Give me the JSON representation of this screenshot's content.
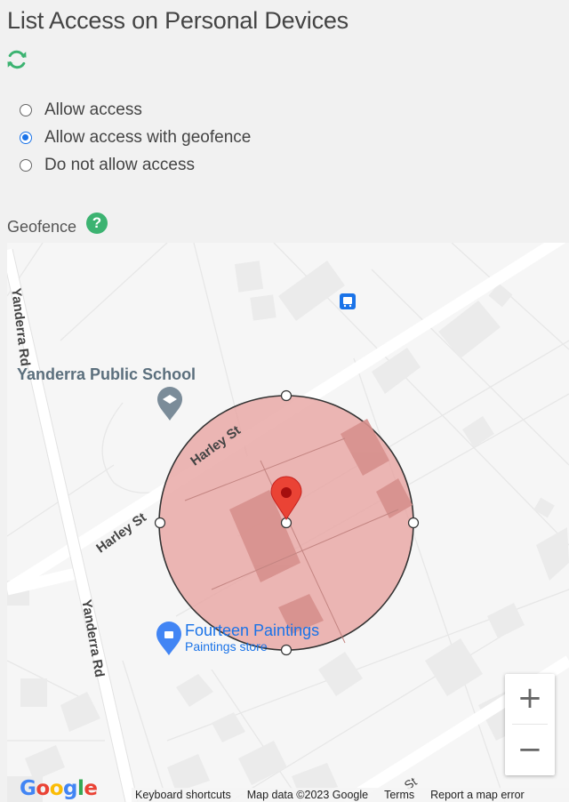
{
  "page": {
    "title": "List Access on Personal Devices",
    "refresh_icon": "refresh-icon",
    "accent_color": "#3cb371"
  },
  "access_options": {
    "selected": "Allow access with geofence",
    "items": [
      {
        "label": "Allow access",
        "checked": false
      },
      {
        "label": "Allow access with geofence",
        "checked": true
      },
      {
        "label": "Do not allow access",
        "checked": false
      }
    ]
  },
  "geofence": {
    "label": "Geofence",
    "help_icon": "?",
    "fill_color": "#e8a6a3",
    "marker_color": "#ea4335"
  },
  "map": {
    "streets": [
      "Yanderra Rd",
      "Harley St",
      "Harley St",
      "Yanderra Rd",
      "St"
    ],
    "places": [
      {
        "name": "Yanderra Public School",
        "icon": "school-icon"
      },
      {
        "name": "Fourteen Paintings",
        "subtitle": "Paintings store",
        "icon": "shopping-bag-icon"
      }
    ],
    "bus_stop_icon": "bus-icon",
    "zoom_in": "+",
    "zoom_out": "−",
    "logo": "Google",
    "footer": {
      "shortcuts": "Keyboard shortcuts",
      "data": "Map data ©2023 Google",
      "terms": "Terms",
      "report": "Report a map error"
    }
  }
}
